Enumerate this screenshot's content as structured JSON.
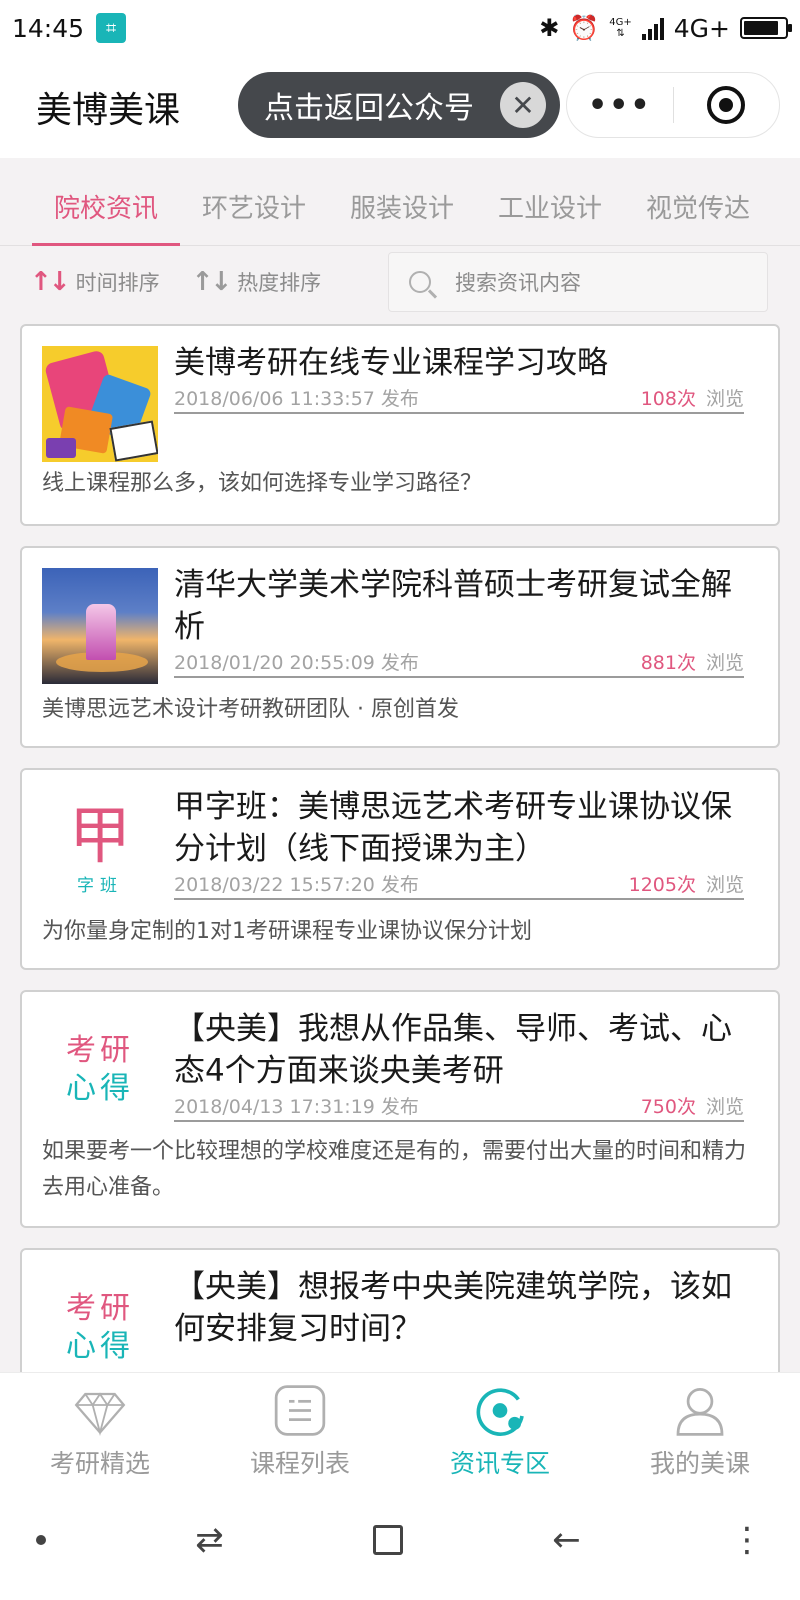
{
  "status_bar": {
    "time": "14:45",
    "network_label": "4G+",
    "network_small_top": "4G+",
    "network_small_bottom": "⇅",
    "icons": [
      "scan-badge-icon",
      "bluetooth-icon",
      "alarm-icon",
      "signal-icon",
      "battery-icon"
    ],
    "battery_level": 0.85
  },
  "header": {
    "title": "美博美课",
    "return_label": "点击返回公众号",
    "close_glyph": "✕",
    "more_glyph": "•••"
  },
  "categories": [
    {
      "label": "院校资讯",
      "active": true
    },
    {
      "label": "环艺设计",
      "active": false
    },
    {
      "label": "服装设计",
      "active": false
    },
    {
      "label": "工业设计",
      "active": false
    },
    {
      "label": "视觉传达",
      "active": false
    }
  ],
  "sort": {
    "by_time": "时间排序",
    "by_heat": "热度排序",
    "icon_glyph": "↑↓"
  },
  "search": {
    "placeholder": "搜索资讯内容"
  },
  "news": [
    {
      "title": "美博考研在线专业课程学习攻略",
      "date": "2018/06/06 11:33:57 发布",
      "views": "108次",
      "views_label": "浏览",
      "summary": "线上课程那么多，该如何选择专业学习路径？",
      "thumb": "pinata-illustration"
    },
    {
      "title": "清华大学美术学院科普硕士考研复试全解析",
      "date": "2018/01/20 20:55:09 发布",
      "views": "881次",
      "views_label": "浏览",
      "summary": "美博思远艺术设计考研教研团队 · 原创首发",
      "thumb": "night-campus-photo"
    },
    {
      "title": "甲字班：美博思远艺术考研专业课协议保分计划（线下面授课为主）",
      "date": "2018/03/22 15:57:20 发布",
      "views": "1205次",
      "views_label": "浏览",
      "summary": "为你量身定制的1对1考研课程专业课协议保分计划",
      "thumb_big": "甲",
      "thumb_small": "字班"
    },
    {
      "title": "【央美】我想从作品集、导师、考试、心态4个方面来谈央美考研",
      "date": "2018/04/13 17:31:19 发布",
      "views": "750次",
      "views_label": "浏览",
      "summary": "如果要考一个比较理想的学校难度还是有的，需要付出大量的时间和精力去用心准备。",
      "thumb_line1": "考研",
      "thumb_line2": "心得"
    },
    {
      "title": "【央美】想报考中央美院建筑学院，该如何安排复习时间？",
      "thumb_line1": "考研",
      "thumb_line2": "心得"
    }
  ],
  "tab_bar": [
    {
      "label": "考研精选",
      "icon": "diamond-icon",
      "active": false
    },
    {
      "label": "课程列表",
      "icon": "list-icon",
      "active": false
    },
    {
      "label": "资讯专区",
      "icon": "news-orbit-icon",
      "active": true
    },
    {
      "label": "我的美课",
      "icon": "user-icon",
      "active": false
    }
  ],
  "system_nav": {
    "switch_glyph": "⇄",
    "back_glyph": "←",
    "menu_glyph": "⋮"
  },
  "colors": {
    "accent_pink": "#e0577f",
    "accent_teal": "#19b5b7",
    "pill_dark": "#45484c"
  }
}
